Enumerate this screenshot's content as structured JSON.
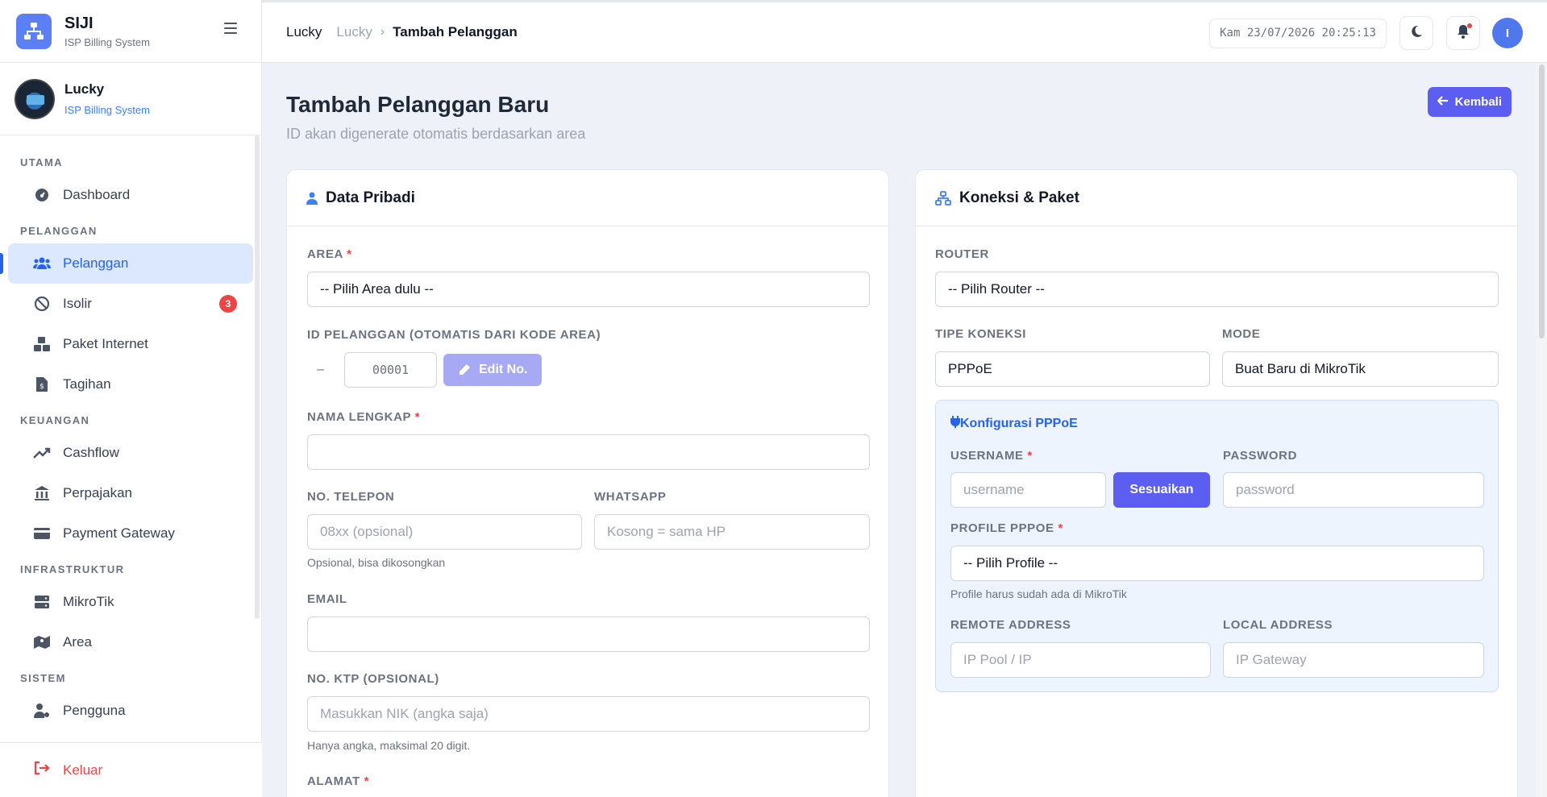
{
  "brand": {
    "name": "SIJI",
    "subtitle": "ISP Billing System"
  },
  "user": {
    "name": "Lucky",
    "role": "ISP Billing System"
  },
  "sidebar": {
    "sections": [
      {
        "title": "UTAMA"
      },
      {
        "title": "PELANGGAN"
      },
      {
        "title": "KEUANGAN"
      },
      {
        "title": "INFRASTRUKTUR"
      },
      {
        "title": "SISTEM"
      }
    ],
    "items": [
      {
        "label": "Dashboard",
        "icon": "dashboard-icon"
      },
      {
        "label": "Pelanggan",
        "icon": "users-icon",
        "active": true
      },
      {
        "label": "Isolir",
        "icon": "ban-icon",
        "badge": "3"
      },
      {
        "label": "Paket Internet",
        "icon": "boxes-icon"
      },
      {
        "label": "Tagihan",
        "icon": "invoice-icon"
      },
      {
        "label": "Cashflow",
        "icon": "trend-icon"
      },
      {
        "label": "Perpajakan",
        "icon": "bank-icon"
      },
      {
        "label": "Payment Gateway",
        "icon": "credit-card-icon"
      },
      {
        "label": "MikroTik",
        "icon": "server-icon"
      },
      {
        "label": "Area",
        "icon": "map-icon"
      },
      {
        "label": "Pengguna",
        "icon": "user-gear-icon"
      }
    ],
    "logout": "Keluar"
  },
  "topbar": {
    "breadcrumb": [
      "Lucky",
      "Lucky",
      "Tambah Pelanggan"
    ],
    "datetime": "Kam 23/07/2026 20:25:13",
    "avatar_initial": "I"
  },
  "page": {
    "title": "Tambah Pelanggan Baru",
    "subtitle": "ID akan digenerate otomatis berdasarkan area",
    "back_label": "Kembali"
  },
  "personal": {
    "title": "Data Pribadi",
    "area_label": "AREA",
    "area_value": "-- Pilih Area dulu --",
    "id_label": "ID PELANGGAN (OTOMATIS DARI KODE AREA)",
    "id_prefix": "–",
    "id_value": "00001",
    "edit_label": "Edit No.",
    "name_label": "NAMA LENGKAP",
    "name_value": "",
    "phone_label": "NO. TELEPON",
    "phone_placeholder": "08xx (opsional)",
    "phone_hint": "Opsional, bisa dikosongkan",
    "wa_label": "WHATSAPP",
    "wa_placeholder": "Kosong = sama HP",
    "email_label": "EMAIL",
    "email_value": "",
    "ktp_label": "NO. KTP (OPSIONAL)",
    "ktp_placeholder": "Masukkan NIK (angka saja)",
    "ktp_hint": "Hanya angka, maksimal 20 digit.",
    "address_label": "ALAMAT",
    "required_mark": "*"
  },
  "connection": {
    "title": "Koneksi & Paket",
    "router_label": "ROUTER",
    "router_value": "-- Pilih Router --",
    "type_label": "TIPE KONEKSI",
    "type_value": "PPPoE",
    "mode_label": "MODE",
    "mode_value": "Buat Baru di MikroTik",
    "pppoe_title": "Konfigurasi PPPoE",
    "username_label": "USERNAME",
    "username_placeholder": "username",
    "adjust_label": "Sesuaikan",
    "password_label": "PASSWORD",
    "password_placeholder": "password",
    "profile_label": "PROFILE PPPOE",
    "profile_value": "-- Pilih Profile --",
    "profile_hint": "Profile harus sudah ada di MikroTik",
    "remote_label": "REMOTE ADDRESS",
    "remote_placeholder": "IP Pool / IP",
    "local_label": "LOCAL ADDRESS",
    "local_placeholder": "IP Gateway"
  },
  "colors": {
    "primary": "#5b5ef0",
    "accent_blue": "#2563eb",
    "danger": "#ef4444"
  }
}
